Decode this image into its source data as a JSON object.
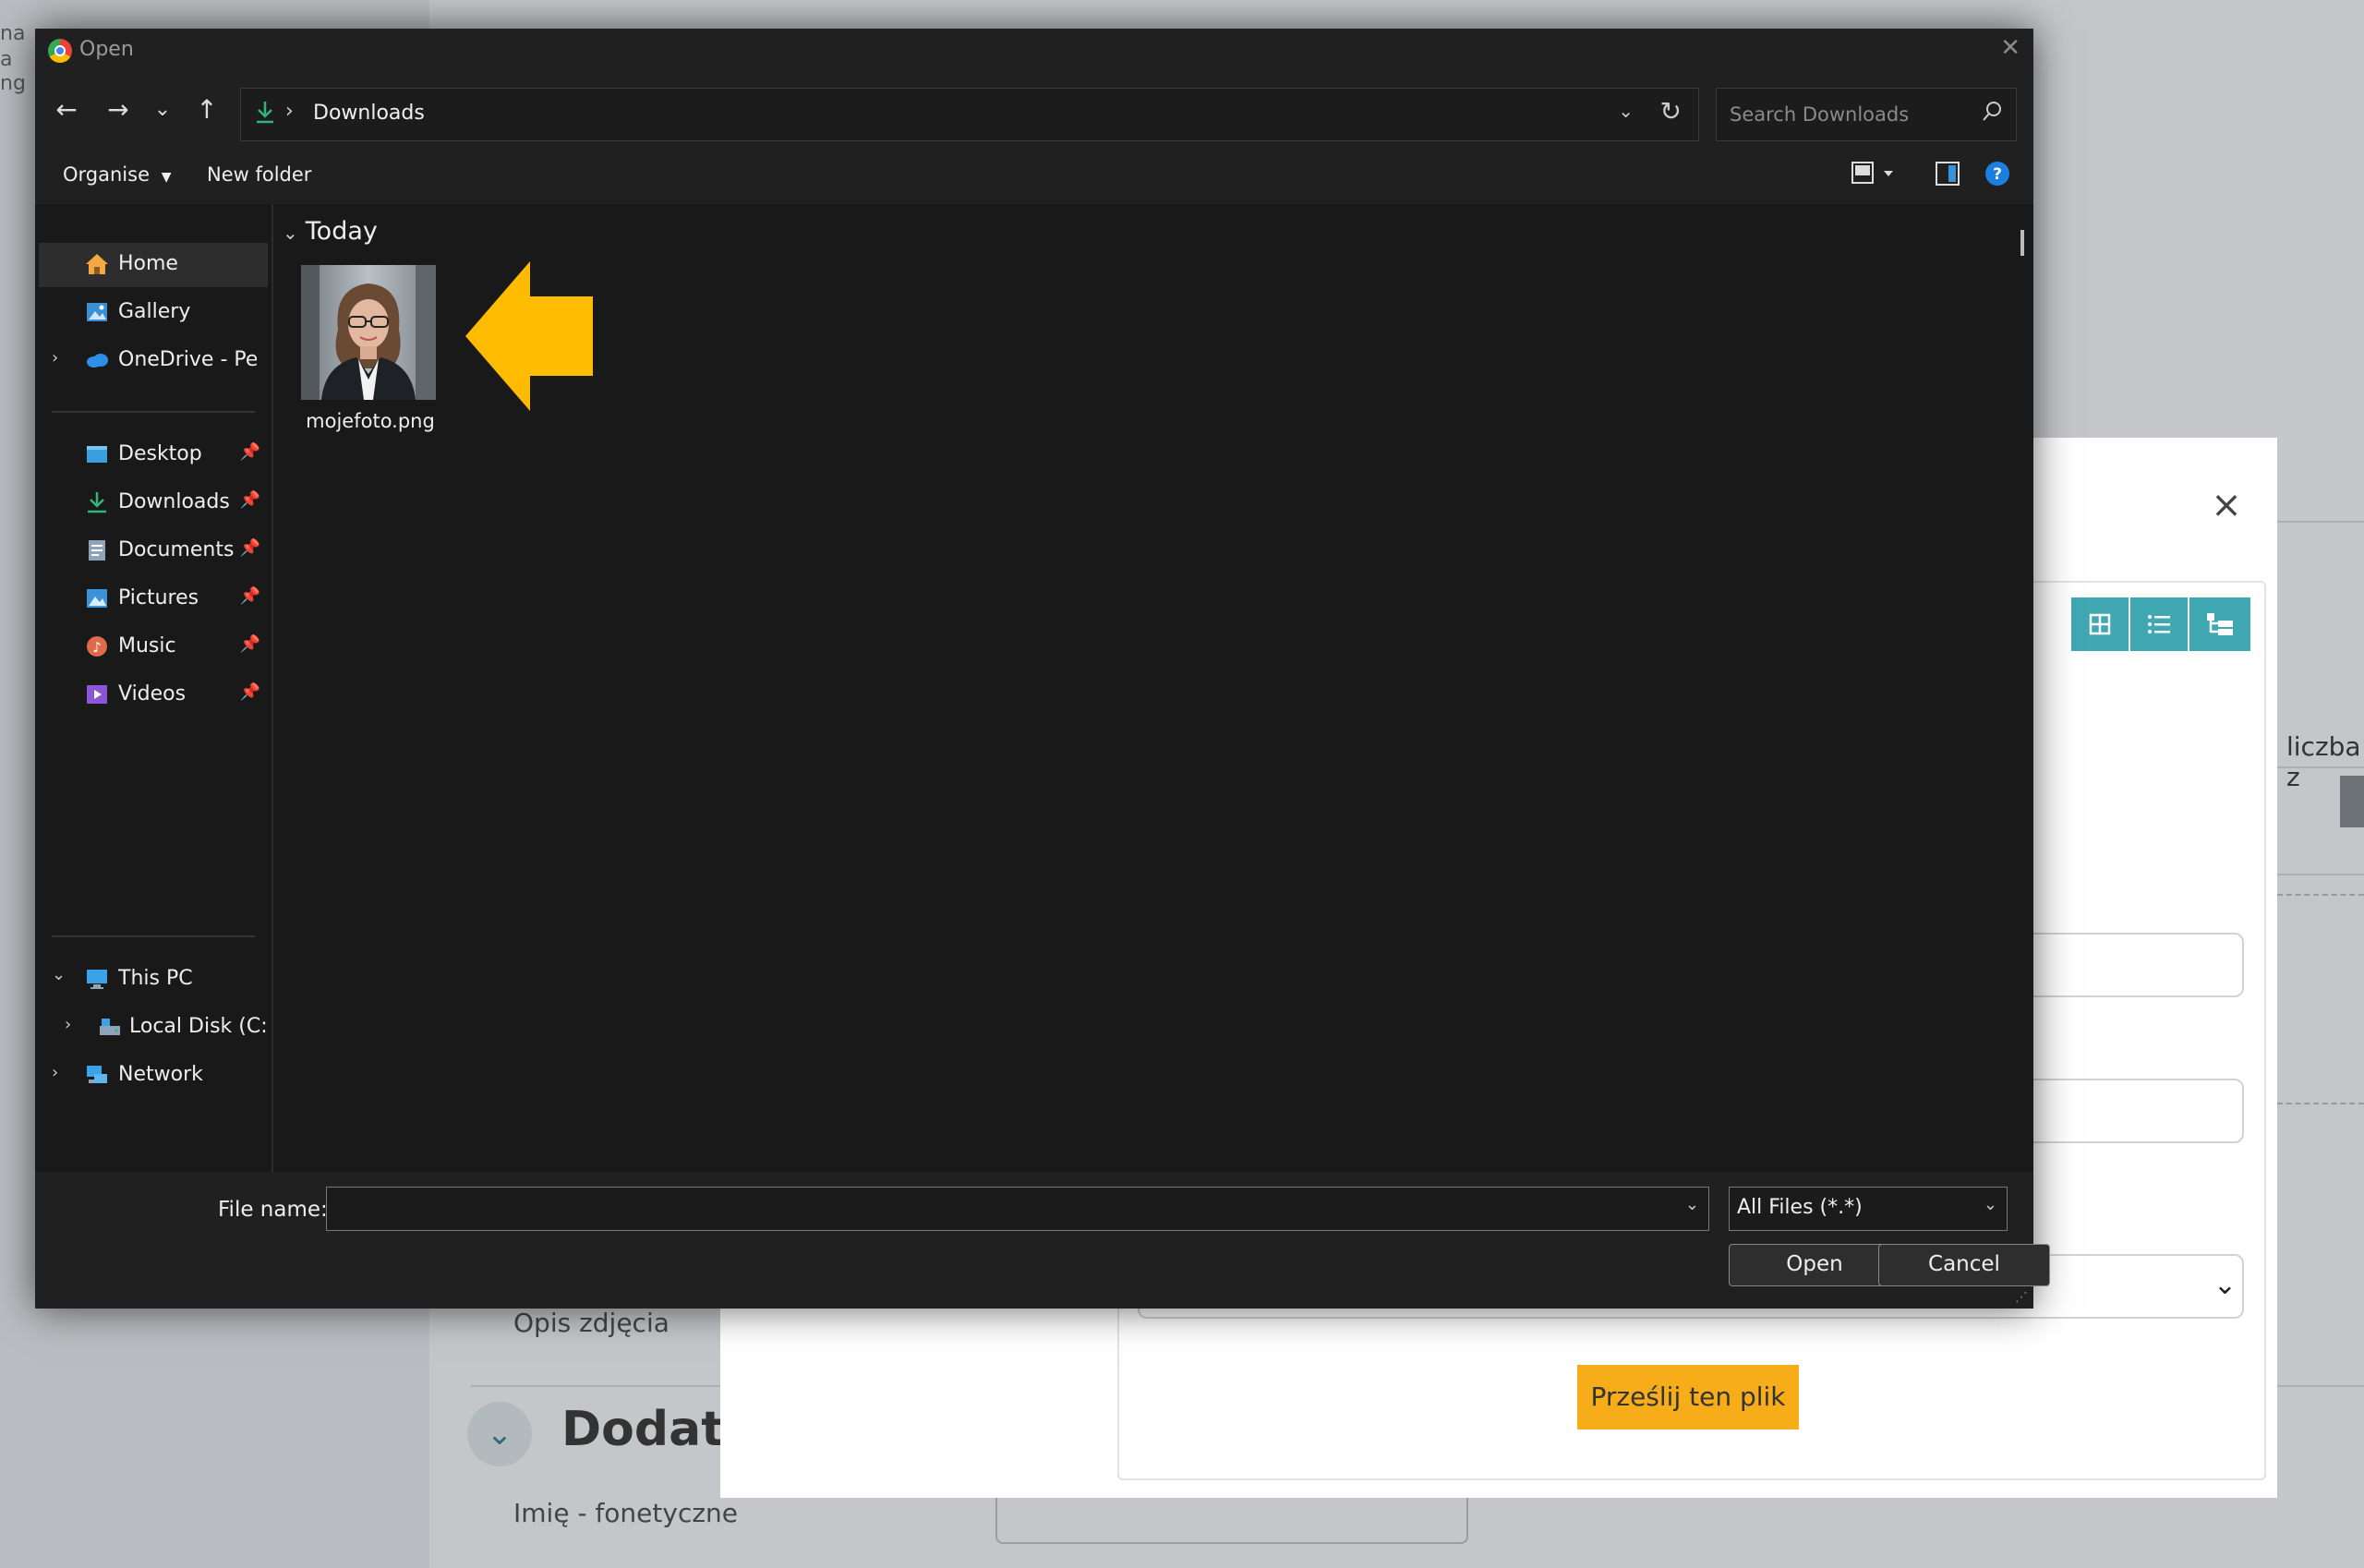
{
  "background_page": {
    "edge_lines": [
      "na",
      "a",
      "ng"
    ],
    "right_label": "liczba z",
    "photo_description_label": "Opis zdjęcia",
    "section_heading": "Dodatk",
    "phonetic_name_label": "Imię - fonetyczne"
  },
  "upload_modal": {
    "close_icon": "×",
    "view_buttons": [
      "grid-icon",
      "list-icon",
      "tree-icon"
    ],
    "upload_button_label": "Prześlij ten plik"
  },
  "dialog": {
    "title": "Open",
    "close_icon": "✕",
    "nav": {
      "back": "←",
      "forward": "→",
      "recent": "⌄",
      "up": "↑"
    },
    "address": {
      "separator": "›",
      "current_folder": "Downloads",
      "dropdown": "⌄",
      "refresh": "↻"
    },
    "search_placeholder": "Search Downloads",
    "commands": {
      "organise": "Organise",
      "new_folder": "New folder"
    },
    "sidebar": {
      "quick": [
        {
          "label": "Home",
          "icon": "home-icon",
          "color": "#f4a742",
          "selected": true
        },
        {
          "label": "Gallery",
          "icon": "gallery-icon",
          "color": "#3a8fd6"
        },
        {
          "label": "OneDrive - Personal",
          "icon": "onedrive-icon",
          "color": "#2f8fe8",
          "expandable": true
        }
      ],
      "pinned": [
        {
          "label": "Desktop",
          "icon": "desktop-icon",
          "color": "#39a0e0"
        },
        {
          "label": "Downloads",
          "icon": "download-icon",
          "color": "#33b37a"
        },
        {
          "label": "Documents",
          "icon": "documents-icon",
          "color": "#8fa4b8"
        },
        {
          "label": "Pictures",
          "icon": "pictures-icon",
          "color": "#3a92d8"
        },
        {
          "label": "Music",
          "icon": "music-icon",
          "color": "#e06a4a"
        },
        {
          "label": "Videos",
          "icon": "videos-icon",
          "color": "#8a55d6"
        }
      ],
      "devices": [
        {
          "label": "This PC",
          "icon": "pc-icon",
          "color": "#3aa2e6"
        },
        {
          "label": "Local Disk (C:)",
          "icon": "disk-icon",
          "color": "#8fa4b8"
        },
        {
          "label": "Network",
          "icon": "network-icon",
          "color": "#3aa2e6"
        }
      ]
    },
    "content": {
      "group_label": "Today",
      "files": [
        {
          "name": "mojefoto.png",
          "type": "image"
        }
      ]
    },
    "footer": {
      "file_name_label": "File name:",
      "file_name_value": "",
      "file_type": "All Files (*.*)",
      "open_button": "Open",
      "cancel_button": "Cancel"
    }
  },
  "colors": {
    "annotation_arrow": "#ffbb00",
    "accent_teal": "#3fa8b3",
    "upload_button": "#f7ac19",
    "help_icon": "#1a7fe0"
  }
}
